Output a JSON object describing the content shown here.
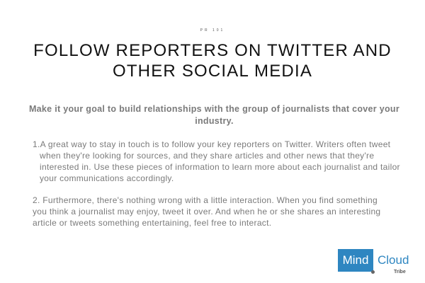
{
  "kicker": "PR 101",
  "title": "FOLLOW REPORTERS ON TWITTER AND OTHER SOCIAL MEDIA",
  "intro": "Make it your goal to build relationships with the group of journalists that cover your industry.",
  "paragraphs": [
    "1.A great way to stay in touch is to follow your key reporters on Twitter. Writers often tweet when they're looking for sources, and they share articles and other news that they're interested in. Use these pieces of information to learn more about each journalist and tailor your communications accordingly.",
    "2. Furthermore, there's nothing wrong with a little interaction. When you find something you think a journalist may enjoy, tweet it over. And when he or she shares an interesting article or tweets something entertaining, feel free to interact."
  ],
  "logo": {
    "mind": "Mind",
    "cloud": "Cloud",
    "tribe": "Tribe",
    "brand_color": "#2e86c1"
  }
}
